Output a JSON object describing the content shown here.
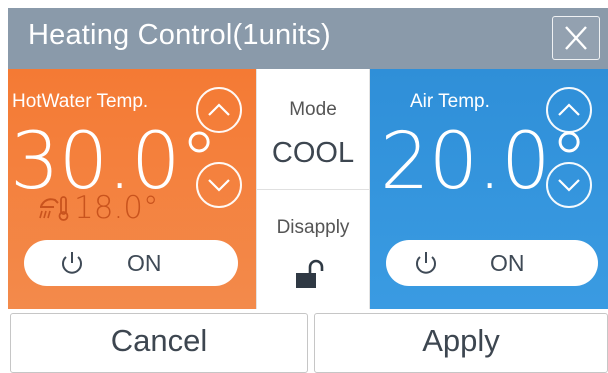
{
  "dialog": {
    "title": "Heating Control(1units)"
  },
  "hot_water": {
    "label": "HotWater Temp.",
    "temperature": "30.0°",
    "current_temperature": "18.0°",
    "power_label": "ON"
  },
  "mode": {
    "label": "Mode",
    "value": "COOL",
    "lock_label": "Disapply"
  },
  "air": {
    "label": "Air Temp.",
    "temperature": "20.0°",
    "power_label": "ON"
  },
  "actions": {
    "cancel_label": "Cancel",
    "apply_label": "Apply"
  },
  "colors": {
    "hot_water_panel": "#f47a34",
    "air_panel": "#2f8fd8",
    "title_bar": "#8a9aaa"
  }
}
